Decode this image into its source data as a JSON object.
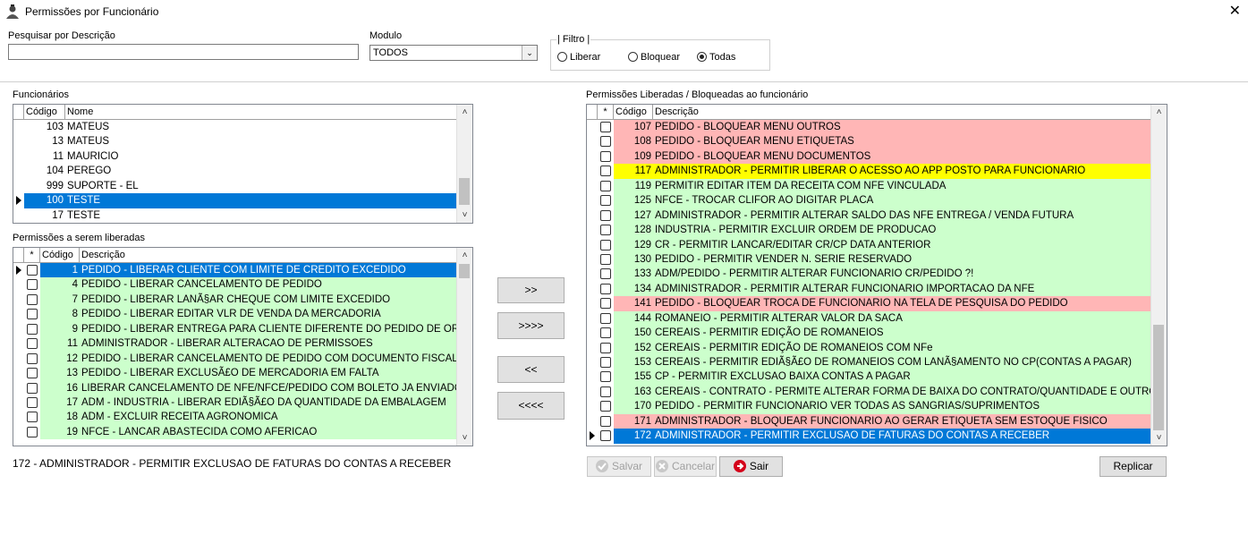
{
  "window": {
    "title": "Permissões por Funcionário"
  },
  "search": {
    "label": "Pesquisar por Descrição",
    "value": ""
  },
  "module": {
    "label": "Modulo",
    "selected": "TODOS"
  },
  "filter": {
    "label": "| Filtro |",
    "options": [
      "Liberar",
      "Bloquear",
      "Todas"
    ],
    "selected": "Todas"
  },
  "employees": {
    "label": "Funcionários",
    "columns": [
      "Código",
      "Nome"
    ],
    "rows": [
      {
        "code": "103",
        "name": "MATEUS"
      },
      {
        "code": "13",
        "name": "MATEUS"
      },
      {
        "code": "11",
        "name": "MAURICIO"
      },
      {
        "code": "104",
        "name": "PEREGO"
      },
      {
        "code": "999",
        "name": "SUPORTE - EL"
      },
      {
        "code": "100",
        "name": "TESTE"
      },
      {
        "code": "17",
        "name": "TESTE"
      }
    ],
    "selected_index": 5
  },
  "to_release": {
    "label": "Permissões a serem liberadas",
    "columns": [
      "*",
      "Código",
      "Descrição"
    ],
    "rows": [
      {
        "code": "1",
        "desc": "PEDIDO - LIBERAR CLIENTE COM LIMITE DE CREDITO EXCEDIDO"
      },
      {
        "code": "4",
        "desc": "PEDIDO - LIBERAR CANCELAMENTO DE PEDIDO"
      },
      {
        "code": "7",
        "desc": "PEDIDO - LIBERAR LANÃ§AR CHEQUE COM LIMITE EXCEDIDO"
      },
      {
        "code": "8",
        "desc": "PEDIDO - LIBERAR EDITAR VLR DE VENDA DA MERCADORIA"
      },
      {
        "code": "9",
        "desc": "PEDIDO - LIBERAR ENTREGA PARA CLIENTE DIFERENTE DO PEDIDO DE OR"
      },
      {
        "code": "11",
        "desc": "ADMINISTRADOR - LIBERAR ALTERACAO DE PERMISSOES"
      },
      {
        "code": "12",
        "desc": "PEDIDO - LIBERAR CANCELAMENTO DE PEDIDO COM DOCUMENTO FISCAL V"
      },
      {
        "code": "13",
        "desc": "PEDIDO - LIBERAR EXCLUSÃ£O DE MERCADORIA EM FALTA"
      },
      {
        "code": "16",
        "desc": "LIBERAR CANCELAMENTO DE NFE/NFCE/PEDIDO COM BOLETO JA ENVIADO"
      },
      {
        "code": "17",
        "desc": "ADM - INDUSTRIA - LIBERAR EDIÃ§Ã£O DA QUANTIDADE DA EMBALAGEM"
      },
      {
        "code": "18",
        "desc": "ADM - EXCLUIR RECEITA AGRONOMICA"
      },
      {
        "code": "19",
        "desc": "NFCE - LANCAR ABASTECIDA COMO AFERICAO"
      }
    ],
    "selected_index": 0
  },
  "transfer_buttons": [
    ">>",
    ">>>>",
    "<<",
    "<<<<"
  ],
  "released": {
    "label": "Permissões Liberadas / Bloqueadas ao funcionário",
    "columns": [
      "*",
      "Código",
      "Descrição"
    ],
    "rows": [
      {
        "code": "107",
        "desc": "PEDIDO - BLOQUEAR MENU OUTROS",
        "color": "red"
      },
      {
        "code": "108",
        "desc": "PEDIDO - BLOQUEAR MENU ETIQUETAS",
        "color": "red"
      },
      {
        "code": "109",
        "desc": "PEDIDO - BLOQUEAR MENU DOCUMENTOS",
        "color": "red"
      },
      {
        "code": "117",
        "desc": "ADMINISTRADOR - PERMITIR LIBERAR O ACESSO AO APP POSTO PARA FUNCIONARIO",
        "color": "yellow"
      },
      {
        "code": "119",
        "desc": "PERMITIR EDITAR ITEM DA RECEITA COM NFE VINCULADA",
        "color": "green"
      },
      {
        "code": "125",
        "desc": "NFCE - TROCAR CLIFOR AO DIGITAR PLACA",
        "color": "green"
      },
      {
        "code": "127",
        "desc": "ADMINISTRADOR - PERMITIR ALTERAR SALDO DAS NFE ENTREGA / VENDA FUTURA",
        "color": "green"
      },
      {
        "code": "128",
        "desc": "INDUSTRIA - PERMITIR EXCLUIR ORDEM DE PRODUCAO",
        "color": "green"
      },
      {
        "code": "129",
        "desc": "CR - PERMITIR LANCAR/EDITAR CR/CP DATA ANTERIOR",
        "color": "green"
      },
      {
        "code": "130",
        "desc": "PEDIDO - PERMITIR VENDER N. SERIE RESERVADO",
        "color": "green"
      },
      {
        "code": "133",
        "desc": "ADM/PEDIDO - PERMITIR ALTERAR FUNCIONARIO CR/PEDIDO ?!",
        "color": "green"
      },
      {
        "code": "134",
        "desc": "ADMINISTRADOR - PERMITIR ALTERAR FUNCIONARIO IMPORTACAO DA NFE",
        "color": "green"
      },
      {
        "code": "141",
        "desc": "PEDIDO - BLOQUEAR TROCA DE FUNCIONARIO NA TELA DE PESQUISA DO PEDIDO",
        "color": "red"
      },
      {
        "code": "144",
        "desc": "ROMANEIO - PERMITIR ALTERAR VALOR DA SACA",
        "color": "green"
      },
      {
        "code": "150",
        "desc": "CEREAIS - PERMITIR EDIÇÃO DE ROMANEIOS",
        "color": "green"
      },
      {
        "code": "152",
        "desc": "CEREAIS - PERMITIR EDIÇÃO DE ROMANEIOS COM NFe",
        "color": "green"
      },
      {
        "code": "153",
        "desc": "CEREAIS - PERMITIR EDIÃ§Ã£O DE ROMANEIOS COM LANÃ§AMENTO NO CP(CONTAS A PAGAR)",
        "color": "green"
      },
      {
        "code": "155",
        "desc": "CP - PERMITIR EXCLUSAO BAIXA CONTAS A PAGAR",
        "color": "green"
      },
      {
        "code": "163",
        "desc": "CEREAIS - CONTRATO - PERMITE ALTERAR FORMA DE BAIXA DO CONTRATO/QUANTIDADE E OUTRO",
        "color": "green"
      },
      {
        "code": "170",
        "desc": "PEDIDO - PERMITIR FUNCIONARIO VER TODAS AS SANGRIAS/SUPRIMENTOS",
        "color": "green"
      },
      {
        "code": "171",
        "desc": "ADMINISTRADOR - BLOQUEAR FUNCIONARIO AO GERAR ETIQUETA SEM ESTOQUE FISICO",
        "color": "red"
      },
      {
        "code": "172",
        "desc": "ADMINISTRADOR - PERMITIR EXCLUSAO DE FATURAS DO CONTAS A RECEBER",
        "color": "sel"
      }
    ],
    "selected_index": 21
  },
  "status_text": "172 - ADMINISTRADOR - PERMITIR EXCLUSAO DE FATURAS DO CONTAS A RECEBER",
  "actions": {
    "save": "Salvar",
    "cancel": "Cancelar",
    "exit": "Sair",
    "replicate": "Replicar"
  }
}
